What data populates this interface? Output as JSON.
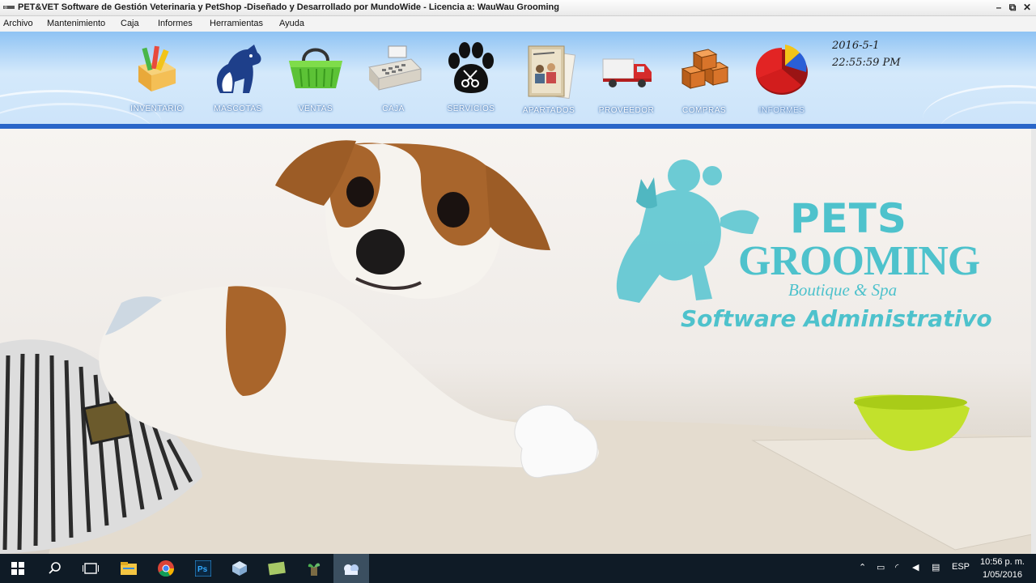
{
  "window": {
    "title": "PET&VET Software de Gestión Veterinaria y PetShop -Diseñado y Desarrollado por MundoWide - Licencia a: WauWau Grooming",
    "minimize": "–",
    "maximize": "⧉",
    "close": "✕"
  },
  "menu": [
    "Archivo",
    "Mantenimiento",
    "Caja",
    "Informes",
    "Herramientas",
    "Ayuda"
  ],
  "toolbar": {
    "items": [
      {
        "label": "INVENTARIO",
        "icon": "inventory-box-icon"
      },
      {
        "label": "MASCOTAS",
        "icon": "pets-icon"
      },
      {
        "label": "VENTAS",
        "icon": "shopping-basket-icon"
      },
      {
        "label": "CAJA",
        "icon": "cash-register-icon"
      },
      {
        "label": "SERVICIOS",
        "icon": "paw-scissors-icon"
      },
      {
        "label": "APARTADOS",
        "icon": "credit-cards-icon"
      },
      {
        "label": "PROVEEDOR",
        "icon": "truck-icon"
      },
      {
        "label": "COMPRAS",
        "icon": "boxes-icon"
      },
      {
        "label": "INFORMES",
        "icon": "pie-chart-icon"
      }
    ],
    "date": "2016-5-1",
    "time": "22:55:59 PM"
  },
  "brand": {
    "pets": "PETS",
    "grooming": "GROOMING",
    "tagline": "Boutique & Spa",
    "subtitle": "Software Administrativo",
    "color": "#4ec2cc"
  },
  "taskbar": {
    "apps": [
      "start-icon",
      "search-icon",
      "task-view-icon",
      "file-explorer-icon",
      "chrome-icon",
      "photoshop-icon",
      "cube-app-icon",
      "notes-app-icon",
      "sprout-app-icon",
      "petvet-app-icon"
    ],
    "language": "ESP",
    "clock_time": "10:56 p. m.",
    "clock_date": "1/05/2016"
  }
}
